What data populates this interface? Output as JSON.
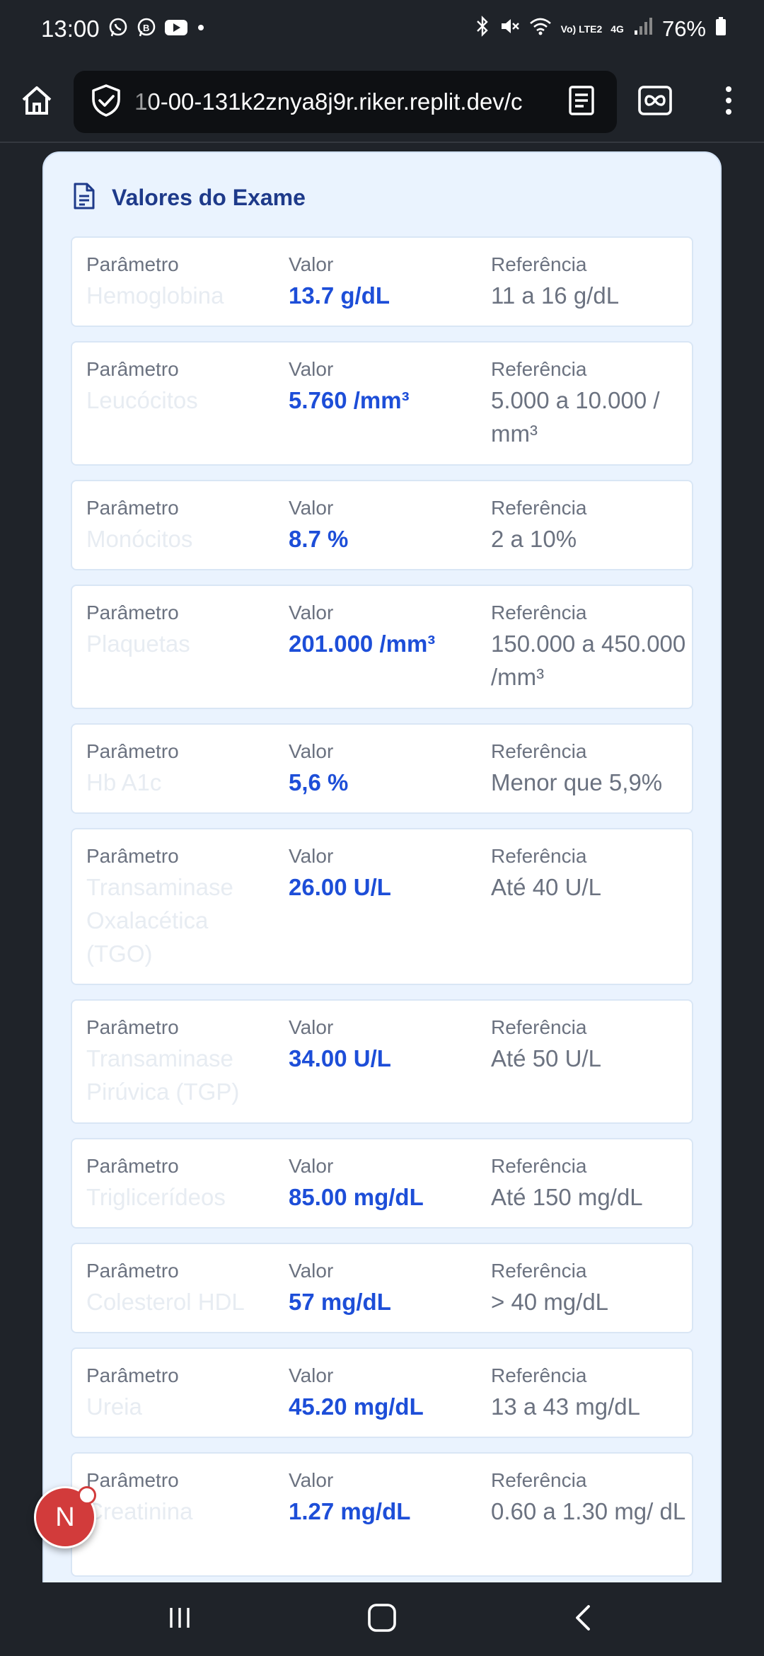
{
  "status_bar": {
    "time": "13:00",
    "app_icons": [
      "whatsapp-icon",
      "whatsapp-business-icon",
      "youtube-icon",
      "notification-dot-icon"
    ],
    "lte_label": "Vo) LTE2",
    "network_label": "4G",
    "battery": "76%"
  },
  "browser": {
    "url": "10-00-131k2znya8j9r.riker.replit.dev/c",
    "icons": [
      "home-icon",
      "shield-check-icon",
      "reader-mode-icon",
      "tabs-icon",
      "overflow-menu-icon"
    ]
  },
  "card": {
    "title": "Valores do Exame",
    "title_icon": "document-icon",
    "rows": [
      {
        "param_label": "Parâmetro",
        "param": "Hemoglobina",
        "value_label": "Valor",
        "value": "13.7 g/dL",
        "ref_label": "Referência",
        "ref": "11 a 16 g/dL"
      },
      {
        "param_label": "Parâmetro",
        "param": "Leucócitos",
        "value_label": "Valor",
        "value": "5.760 /mm³",
        "ref_label": "Referência",
        "ref": "5.000 a 10.000 / mm³"
      },
      {
        "param_label": "Parâmetro",
        "param": "Monócitos",
        "value_label": "Valor",
        "value": "8.7 %",
        "ref_label": "Referência",
        "ref": "2 a 10%"
      },
      {
        "param_label": "Parâmetro",
        "param": "Plaquetas",
        "value_label": "Valor",
        "value": "201.000 /mm³",
        "ref_label": "Referência",
        "ref": "150.000 a 450.000 /mm³"
      },
      {
        "param_label": "Parâmetro",
        "param": "Hb A1c",
        "value_label": "Valor",
        "value": "5,6 %",
        "ref_label": "Referência",
        "ref": "Menor que 5,9%"
      },
      {
        "param_label": "Parâmetro",
        "param": "Transaminase Oxalacética (TGO)",
        "value_label": "Valor",
        "value": "26.00 U/L",
        "ref_label": "Referência",
        "ref": "Até 40 U/L"
      },
      {
        "param_label": "Parâmetro",
        "param": "Transaminase Pirúvica (TGP)",
        "value_label": "Valor",
        "value": "34.00 U/L",
        "ref_label": "Referência",
        "ref": "Até 50 U/L"
      },
      {
        "param_label": "Parâmetro",
        "param": "Triglicerídeos",
        "value_label": "Valor",
        "value": "85.00 mg/dL",
        "ref_label": "Referência",
        "ref": "Até 150 mg/dL"
      },
      {
        "param_label": "Parâmetro",
        "param": "Colesterol HDL",
        "value_label": "Valor",
        "value": "57 mg/dL",
        "ref_label": "Referência",
        "ref": "> 40 mg/dL"
      },
      {
        "param_label": "Parâmetro",
        "param": "Ureia",
        "value_label": "Valor",
        "value": "45.20 mg/dL",
        "ref_label": "Referência",
        "ref": "13 a 43 mg/dL"
      },
      {
        "param_label": "Parâmetro",
        "param": "Creatinina",
        "value_label": "Valor",
        "value": "1.27 mg/dL",
        "ref_label": "Referência",
        "ref": "0.60 a 1.30 mg/ dL"
      }
    ]
  },
  "floating_button": {
    "label": "N"
  },
  "nav_bar": {
    "icons": [
      "recent-apps-icon",
      "home-nav-icon",
      "back-icon"
    ]
  },
  "colors": {
    "background": "#1f2329",
    "card": "#eaf3fe",
    "title": "#1e3a8a",
    "value": "#1d4ed8",
    "label": "#6b7280",
    "fab": "#d23b3b"
  }
}
